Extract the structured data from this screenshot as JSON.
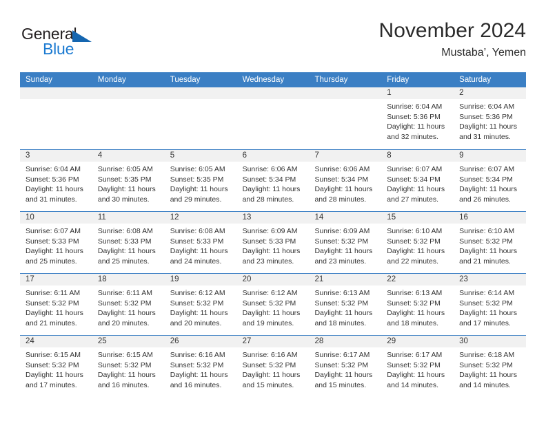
{
  "brand": {
    "word1": "General",
    "word2": "Blue",
    "triangle_icon": "blue-triangle-icon",
    "accent_color": "#1b7ad1"
  },
  "header": {
    "title": "November 2024",
    "subtitle": "Mustaba’, Yemen"
  },
  "theme": {
    "header_blue": "#3b7fc4",
    "day_band_gray": "#f1f1f1",
    "text": "#333333"
  },
  "weekday_headers": [
    "Sunday",
    "Monday",
    "Tuesday",
    "Wednesday",
    "Thursday",
    "Friday",
    "Saturday"
  ],
  "weeks": [
    [
      {
        "day": "",
        "lines": []
      },
      {
        "day": "",
        "lines": []
      },
      {
        "day": "",
        "lines": []
      },
      {
        "day": "",
        "lines": []
      },
      {
        "day": "",
        "lines": []
      },
      {
        "day": "1",
        "lines": [
          "Sunrise: 6:04 AM",
          "Sunset: 5:36 PM",
          "Daylight: 11 hours",
          "and 32 minutes."
        ]
      },
      {
        "day": "2",
        "lines": [
          "Sunrise: 6:04 AM",
          "Sunset: 5:36 PM",
          "Daylight: 11 hours",
          "and 31 minutes."
        ]
      }
    ],
    [
      {
        "day": "3",
        "lines": [
          "Sunrise: 6:04 AM",
          "Sunset: 5:36 PM",
          "Daylight: 11 hours",
          "and 31 minutes."
        ]
      },
      {
        "day": "4",
        "lines": [
          "Sunrise: 6:05 AM",
          "Sunset: 5:35 PM",
          "Daylight: 11 hours",
          "and 30 minutes."
        ]
      },
      {
        "day": "5",
        "lines": [
          "Sunrise: 6:05 AM",
          "Sunset: 5:35 PM",
          "Daylight: 11 hours",
          "and 29 minutes."
        ]
      },
      {
        "day": "6",
        "lines": [
          "Sunrise: 6:06 AM",
          "Sunset: 5:34 PM",
          "Daylight: 11 hours",
          "and 28 minutes."
        ]
      },
      {
        "day": "7",
        "lines": [
          "Sunrise: 6:06 AM",
          "Sunset: 5:34 PM",
          "Daylight: 11 hours",
          "and 28 minutes."
        ]
      },
      {
        "day": "8",
        "lines": [
          "Sunrise: 6:07 AM",
          "Sunset: 5:34 PM",
          "Daylight: 11 hours",
          "and 27 minutes."
        ]
      },
      {
        "day": "9",
        "lines": [
          "Sunrise: 6:07 AM",
          "Sunset: 5:34 PM",
          "Daylight: 11 hours",
          "and 26 minutes."
        ]
      }
    ],
    [
      {
        "day": "10",
        "lines": [
          "Sunrise: 6:07 AM",
          "Sunset: 5:33 PM",
          "Daylight: 11 hours",
          "and 25 minutes."
        ]
      },
      {
        "day": "11",
        "lines": [
          "Sunrise: 6:08 AM",
          "Sunset: 5:33 PM",
          "Daylight: 11 hours",
          "and 25 minutes."
        ]
      },
      {
        "day": "12",
        "lines": [
          "Sunrise: 6:08 AM",
          "Sunset: 5:33 PM",
          "Daylight: 11 hours",
          "and 24 minutes."
        ]
      },
      {
        "day": "13",
        "lines": [
          "Sunrise: 6:09 AM",
          "Sunset: 5:33 PM",
          "Daylight: 11 hours",
          "and 23 minutes."
        ]
      },
      {
        "day": "14",
        "lines": [
          "Sunrise: 6:09 AM",
          "Sunset: 5:32 PM",
          "Daylight: 11 hours",
          "and 23 minutes."
        ]
      },
      {
        "day": "15",
        "lines": [
          "Sunrise: 6:10 AM",
          "Sunset: 5:32 PM",
          "Daylight: 11 hours",
          "and 22 minutes."
        ]
      },
      {
        "day": "16",
        "lines": [
          "Sunrise: 6:10 AM",
          "Sunset: 5:32 PM",
          "Daylight: 11 hours",
          "and 21 minutes."
        ]
      }
    ],
    [
      {
        "day": "17",
        "lines": [
          "Sunrise: 6:11 AM",
          "Sunset: 5:32 PM",
          "Daylight: 11 hours",
          "and 21 minutes."
        ]
      },
      {
        "day": "18",
        "lines": [
          "Sunrise: 6:11 AM",
          "Sunset: 5:32 PM",
          "Daylight: 11 hours",
          "and 20 minutes."
        ]
      },
      {
        "day": "19",
        "lines": [
          "Sunrise: 6:12 AM",
          "Sunset: 5:32 PM",
          "Daylight: 11 hours",
          "and 20 minutes."
        ]
      },
      {
        "day": "20",
        "lines": [
          "Sunrise: 6:12 AM",
          "Sunset: 5:32 PM",
          "Daylight: 11 hours",
          "and 19 minutes."
        ]
      },
      {
        "day": "21",
        "lines": [
          "Sunrise: 6:13 AM",
          "Sunset: 5:32 PM",
          "Daylight: 11 hours",
          "and 18 minutes."
        ]
      },
      {
        "day": "22",
        "lines": [
          "Sunrise: 6:13 AM",
          "Sunset: 5:32 PM",
          "Daylight: 11 hours",
          "and 18 minutes."
        ]
      },
      {
        "day": "23",
        "lines": [
          "Sunrise: 6:14 AM",
          "Sunset: 5:32 PM",
          "Daylight: 11 hours",
          "and 17 minutes."
        ]
      }
    ],
    [
      {
        "day": "24",
        "lines": [
          "Sunrise: 6:15 AM",
          "Sunset: 5:32 PM",
          "Daylight: 11 hours",
          "and 17 minutes."
        ]
      },
      {
        "day": "25",
        "lines": [
          "Sunrise: 6:15 AM",
          "Sunset: 5:32 PM",
          "Daylight: 11 hours",
          "and 16 minutes."
        ]
      },
      {
        "day": "26",
        "lines": [
          "Sunrise: 6:16 AM",
          "Sunset: 5:32 PM",
          "Daylight: 11 hours",
          "and 16 minutes."
        ]
      },
      {
        "day": "27",
        "lines": [
          "Sunrise: 6:16 AM",
          "Sunset: 5:32 PM",
          "Daylight: 11 hours",
          "and 15 minutes."
        ]
      },
      {
        "day": "28",
        "lines": [
          "Sunrise: 6:17 AM",
          "Sunset: 5:32 PM",
          "Daylight: 11 hours",
          "and 15 minutes."
        ]
      },
      {
        "day": "29",
        "lines": [
          "Sunrise: 6:17 AM",
          "Sunset: 5:32 PM",
          "Daylight: 11 hours",
          "and 14 minutes."
        ]
      },
      {
        "day": "30",
        "lines": [
          "Sunrise: 6:18 AM",
          "Sunset: 5:32 PM",
          "Daylight: 11 hours",
          "and 14 minutes."
        ]
      }
    ]
  ]
}
